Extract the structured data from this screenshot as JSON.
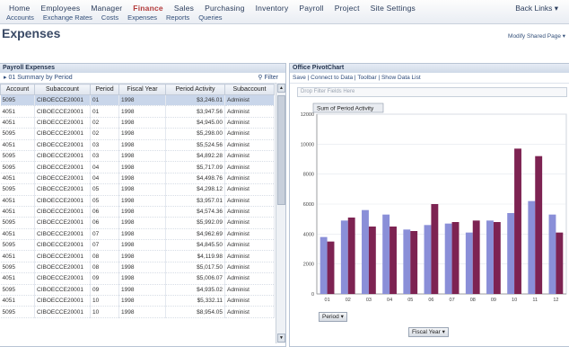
{
  "topnav": {
    "items": [
      {
        "label": "Home",
        "active": false
      },
      {
        "label": "Employees",
        "active": false
      },
      {
        "label": "Manager",
        "active": false
      },
      {
        "label": "Finance",
        "active": true
      },
      {
        "label": "Sales",
        "active": false
      },
      {
        "label": "Purchasing",
        "active": false
      },
      {
        "label": "Inventory",
        "active": false
      },
      {
        "label": "Payroll",
        "active": false
      },
      {
        "label": "Project",
        "active": false
      },
      {
        "label": "Site Settings",
        "active": false
      }
    ],
    "back_link": "Back Links ▾",
    "submenu": [
      "Accounts",
      "Exchange Rates",
      "Costs",
      "Expenses",
      "Reports",
      "Queries"
    ]
  },
  "page": {
    "title": "Expenses",
    "modify_link": "Modify Shared Page ▾"
  },
  "grid": {
    "panel_title": "Payroll Expenses",
    "group_label": "▸ 01 Summary by Period",
    "filter_label": "Filter",
    "columns": [
      "Account",
      "Subaccount",
      "Period",
      "Fiscal Year",
      "Period Activity",
      "Subaccount"
    ],
    "rows": [
      [
        "5095",
        "CIBOECCE20001",
        "01",
        "1998",
        "$3,246.01",
        "Administ"
      ],
      [
        "4051",
        "CIBOECCE20001",
        "01",
        "1998",
        "$3,947.56",
        "Administ"
      ],
      [
        "4051",
        "CIBOECCE20001",
        "02",
        "1998",
        "$4,945.00",
        "Administ"
      ],
      [
        "5095",
        "CIBOECCE20001",
        "02",
        "1998",
        "$5,298.00",
        "Administ"
      ],
      [
        "4051",
        "CIBOECCE20001",
        "03",
        "1998",
        "$5,524.56",
        "Administ"
      ],
      [
        "5095",
        "CIBOECCE20001",
        "03",
        "1998",
        "$4,892.28",
        "Administ"
      ],
      [
        "5095",
        "CIBOECCE20001",
        "04",
        "1998",
        "$5,717.09",
        "Administ"
      ],
      [
        "4051",
        "CIBOECCE20001",
        "04",
        "1998",
        "$4,498.76",
        "Administ"
      ],
      [
        "5095",
        "CIBOECCE20001",
        "05",
        "1998",
        "$4,298.12",
        "Administ"
      ],
      [
        "4051",
        "CIBOECCE20001",
        "05",
        "1998",
        "$3,957.01",
        "Administ"
      ],
      [
        "4051",
        "CIBOECCE20001",
        "06",
        "1998",
        "$4,574.36",
        "Administ"
      ],
      [
        "5095",
        "CIBOECCE20001",
        "06",
        "1998",
        "$5,992.09",
        "Administ"
      ],
      [
        "4051",
        "CIBOECCE20001",
        "07",
        "1998",
        "$4,962.69",
        "Administ"
      ],
      [
        "5095",
        "CIBOECCE20001",
        "07",
        "1998",
        "$4,845.50",
        "Administ"
      ],
      [
        "4051",
        "CIBOECCE20001",
        "08",
        "1998",
        "$4,119.98",
        "Administ"
      ],
      [
        "5095",
        "CIBOECCE20001",
        "08",
        "1998",
        "$5,017.50",
        "Administ"
      ],
      [
        "4051",
        "CIBOECCE20001",
        "09",
        "1998",
        "$5,006.07",
        "Administ"
      ],
      [
        "5095",
        "CIBOECCE20001",
        "09",
        "1998",
        "$4,935.02",
        "Administ"
      ],
      [
        "4051",
        "CIBOECCE20001",
        "10",
        "1998",
        "$5,332.11",
        "Administ"
      ],
      [
        "5095",
        "CIBOECCE20001",
        "10",
        "1998",
        "$8,954.05",
        "Administ"
      ]
    ]
  },
  "pivot": {
    "panel_title": "Office PivotChart",
    "toolbar": [
      "Save",
      "Connect to Data",
      "Toolbar",
      "Show Data List"
    ],
    "filter_drop": "Drop Filter Fields Here",
    "category_field": "Period ▾",
    "series_field": "Fiscal Year ▾"
  },
  "chart_data": {
    "type": "bar",
    "title": "Sum of Period Activity",
    "categories": [
      "01",
      "02",
      "03",
      "04",
      "05",
      "06",
      "07",
      "08",
      "09",
      "10",
      "11",
      "12"
    ],
    "series": [
      {
        "values": [
          3800,
          4900,
          5600,
          5300,
          4300,
          4600,
          4700,
          4100,
          4900,
          5400,
          6200,
          5300
        ],
        "color": "#8a8fd8"
      },
      {
        "values": [
          3500,
          5100,
          4500,
          4500,
          4200,
          6000,
          4800,
          4900,
          4800,
          9700,
          9200,
          4100
        ],
        "color": "#7d2352"
      }
    ],
    "ylim": [
      0,
      12000
    ],
    "yticks": [
      0,
      2000,
      4000,
      6000,
      8000,
      10000,
      12000
    ],
    "ytick_labels": [
      "0",
      "2000",
      "4000",
      "6000",
      "8000",
      "10000",
      "12000"
    ]
  },
  "colors": {
    "accent": "#b33a3a",
    "series_blue": "#8a8fd8",
    "series_maroon": "#7d2352"
  }
}
